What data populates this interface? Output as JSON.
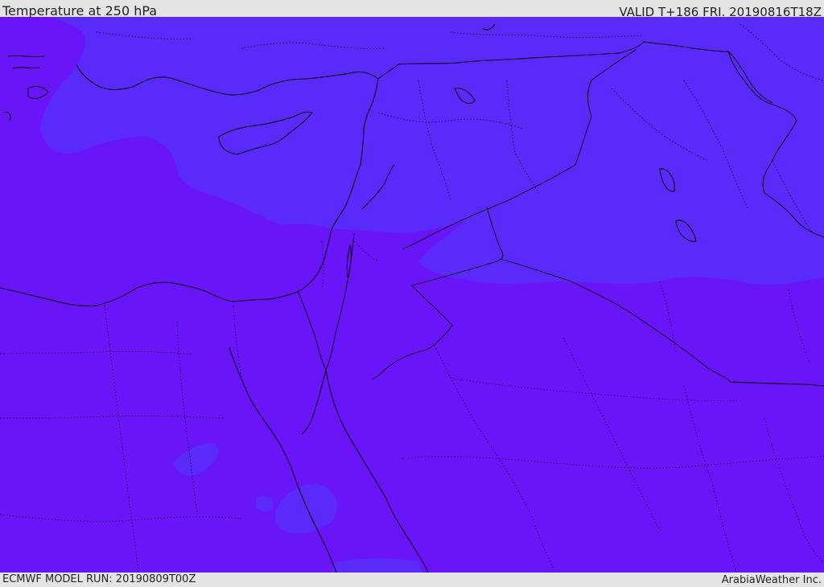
{
  "header": {
    "title": "Temperature at 250 hPa",
    "valid_time": "VALID T+186 FRI. 20190816T18Z"
  },
  "footer": {
    "model_run": "ECMWF MODEL RUN: 20190809T00Z",
    "credit": "ArabiaWeather Inc."
  },
  "map": {
    "colors": {
      "warm_band": "#6a14fa",
      "cool_band": "#5a2afa",
      "coastline": "#000000",
      "border": "#000000"
    }
  }
}
